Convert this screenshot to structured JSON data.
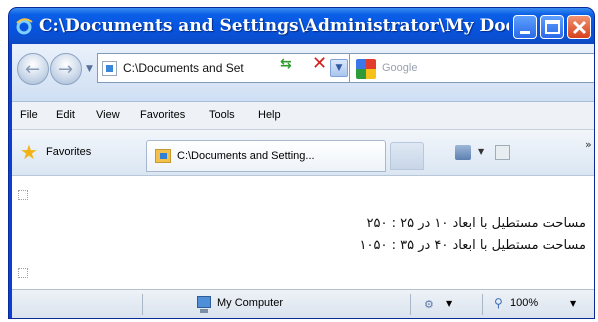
{
  "window": {
    "title": "C:\\Documents and Settings\\Administrator\\My Doc..."
  },
  "toolbar": {
    "address_value": "C:\\Documents and Set",
    "search_placeholder": "Google"
  },
  "menu": {
    "items": [
      "File",
      "Edit",
      "View",
      "Favorites",
      "Tools",
      "Help"
    ]
  },
  "favorites": {
    "label": "Favorites",
    "tab_label": "C:\\Documents and Setting..."
  },
  "content": {
    "lines": [
      "مساحت مستطیل با ابعاد ۱۰ در ۲۵ : ۲۵۰",
      "مساحت مستطیل با ابعاد ۴۰ در ۳۵ : ۱۰۵۰"
    ]
  },
  "status": {
    "zone": "My Computer",
    "zoom": "100%"
  },
  "icons": {
    "app": "internet-explorer-icon",
    "back": "back-arrow-icon",
    "forward": "forward-arrow-icon",
    "refresh": "refresh-icon",
    "stop": "stop-icon",
    "favorites": "star-icon",
    "home": "home-icon",
    "feed": "feed-icon",
    "computer": "computer-icon",
    "zoom": "magnifier-icon"
  },
  "colors": {
    "titlebar": "#0654e0",
    "close_button": "#d6411b"
  }
}
